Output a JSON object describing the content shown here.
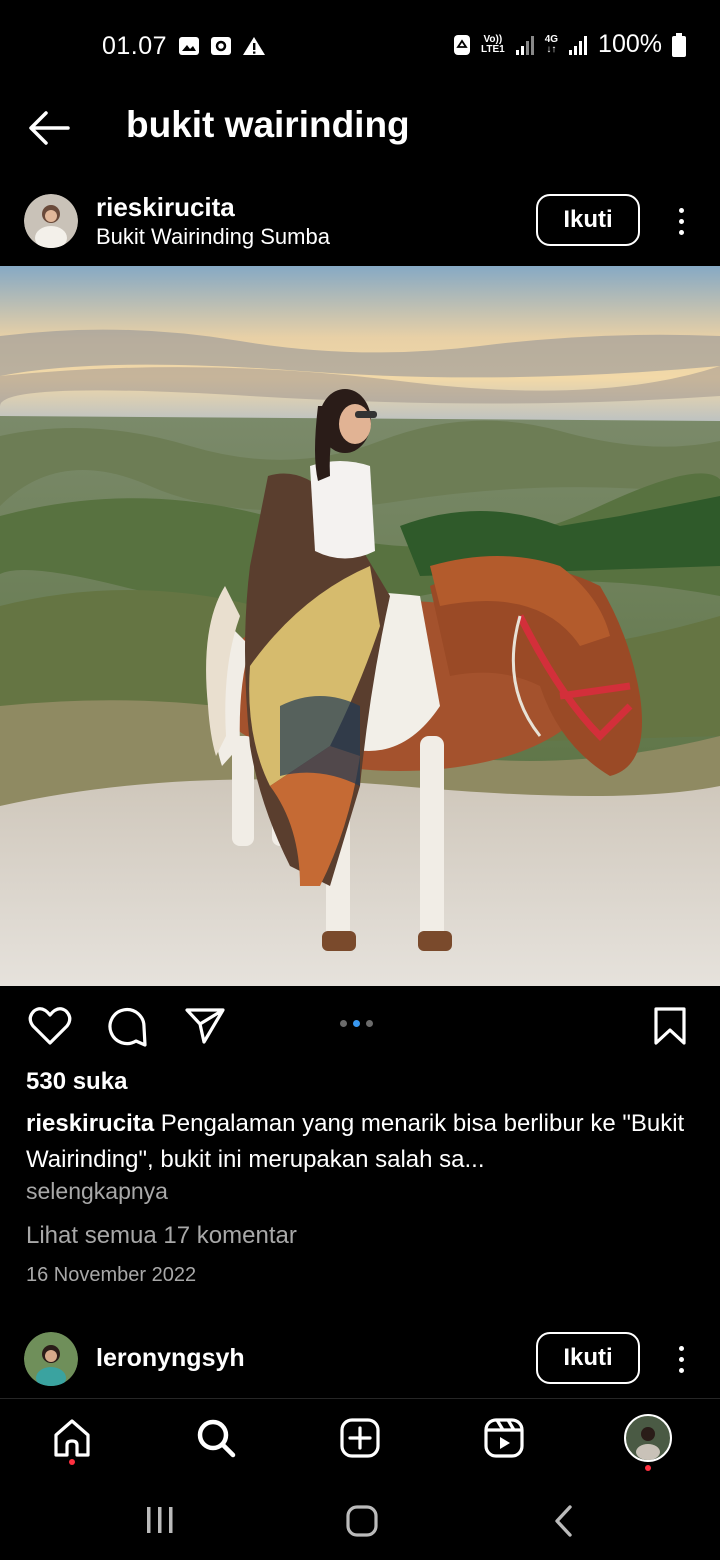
{
  "status_bar": {
    "time": "01.07",
    "left_icons": [
      "image-icon",
      "screenshot-icon",
      "warning-icon"
    ],
    "volte_label": "Vo))",
    "lte_label": "LTE1",
    "network_label": "4G",
    "battery": "100%"
  },
  "header": {
    "title": "bukit wairinding",
    "back_icon": "arrow-left-icon"
  },
  "post": {
    "username": "rieskirucita",
    "location": "Bukit Wairinding Sumba",
    "follow_label": "Ikuti",
    "carousel": {
      "count": 3,
      "active_index": 1
    },
    "likes": "530 suka",
    "caption_user": "rieskirucita",
    "caption_text": " Pengalaman yang menarik bisa berlibur ke \"Bukit Wairinding\", bukit ini merupakan salah sa...",
    "more_label": "selengkapnya",
    "comments_label": "Lihat semua 17 komentar",
    "date": "16 November 2022"
  },
  "next_post": {
    "username": "leronyngsyh",
    "follow_label": "Ikuti"
  },
  "bottom_nav": {
    "items": [
      "home-icon",
      "search-icon",
      "create-icon",
      "reels-icon",
      "profile-avatar"
    ]
  },
  "colors": {
    "background": "#000000",
    "text": "#ffffff",
    "muted": "#a8a8a8",
    "accent_blue": "#3897f0",
    "notification_red": "#ff3040"
  }
}
